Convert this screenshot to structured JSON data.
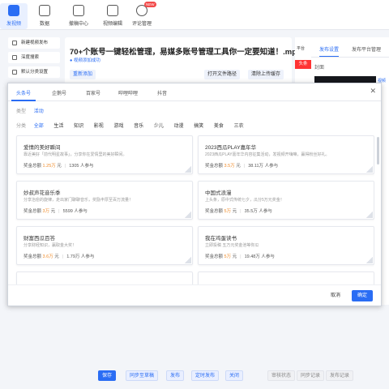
{
  "nav": [
    {
      "label": "发视频",
      "icon": "video-upload-icon",
      "active": true
    },
    {
      "label": "数据",
      "icon": "data-icon",
      "active": false
    },
    {
      "label": "撤稿中心",
      "icon": "home-icon",
      "active": false
    },
    {
      "label": "视频编辑",
      "icon": "video-edit-icon",
      "active": false
    },
    {
      "label": "评论管理",
      "icon": "comment-icon",
      "active": false,
      "badge": "NEW"
    }
  ],
  "sidebar": [
    {
      "label": "新建视频发布",
      "icon": "new-publish-icon"
    },
    {
      "label": "深度搜索",
      "icon": "search-icon"
    },
    {
      "label": "默认分类设置",
      "icon": "category-settings-icon"
    }
  ],
  "main": {
    "video_title": "70+个账号一键轻松管理，易媒多账号管理工具你一定要知道！.mp4",
    "subtitle": "视频添加成功",
    "buttons": {
      "re_add": "重新添加",
      "open_path": "打开文件路径",
      "clear_cache": "清除上传缓存"
    }
  },
  "right_panel": {
    "vertical_label": "平台",
    "tabs": [
      "发布设置",
      "发布平台管理"
    ],
    "cover_label": "封面",
    "red_label": "头条",
    "side_text": "视频中"
  },
  "modal": {
    "platform_tabs": [
      "头条号",
      "企鹅号",
      "百家号",
      "哔哩哔哩",
      "抖音"
    ],
    "type_label": "类型",
    "type_value": "活动",
    "category_label": "分类",
    "categories": [
      "全部",
      "生活",
      "知识",
      "影视",
      "游戏",
      "音乐",
      "少儿",
      "动漫",
      "搞笑",
      "美食",
      "三农"
    ],
    "cards": [
      {
        "title": "爱情的美好瞬间",
        "desc": "靠近美好「前代明星故事」，分享你在爱情里的美好瞬间。",
        "prize_label": "奖金总额",
        "prize": "1.25万",
        "prize_unit": "元",
        "people": "1305 人参与"
      },
      {
        "title": "2023西瓜PLAY嘉年华",
        "desc": "2023西瓜PLAY嘉年华内容征集活动，发视频开嗨嘛，赢得粉丝好礼。",
        "prize_label": "奖金总额",
        "prize": "3.5万",
        "prize_unit": "元",
        "people": "38.11万 人参与"
      },
      {
        "title": "妙叔声花音乐季",
        "desc": "分享治愈的旋律，走出家门聊聊音乐，奖励丰厚至百万流量！",
        "prize_label": "奖金总额",
        "prize": "3万",
        "prize_unit": "元",
        "people": "5599 人参与"
      },
      {
        "title": "中国式浪漫",
        "desc": "上头条，原中式传统七夕，瓜分5万元奖金！",
        "prize_label": "奖金总额",
        "prize": "5万",
        "prize_unit": "元",
        "people": "35.5万 人参与"
      },
      {
        "title": "财富西瓜百答",
        "desc": "分享财经知识，赢取金大奖！",
        "prize_label": "奖金总额",
        "prize": "3.6万",
        "prize_unit": "元",
        "people": "1.79万 人参与"
      },
      {
        "title": "我在鸡蛋读书",
        "desc": "立即投稿 五万元奖金池等你瓜",
        "prize_label": "奖金总额",
        "prize": "5万",
        "prize_unit": "元",
        "people": "19.48万 人参与"
      },
      {
        "title": "",
        "desc": "",
        "prize_label": "",
        "prize": "",
        "prize_unit": "",
        "people": ""
      },
      {
        "title": "",
        "desc": "",
        "prize_label": "",
        "prize": "",
        "prize_unit": "",
        "people": ""
      }
    ],
    "cancel": "取消",
    "confirm": "确定"
  },
  "bottom_bar": {
    "save": "保存",
    "sync_draft": "同步至草稿",
    "publish": "发布",
    "scheduled": "定时发布",
    "close": "关闭",
    "review_status": "审核状态",
    "sync_record": "同步记录",
    "publish_record": "发布记录"
  },
  "colors": {
    "accent": "#2a6df4",
    "prize": "#f08c2a",
    "badge_red": "#f24a4a"
  }
}
